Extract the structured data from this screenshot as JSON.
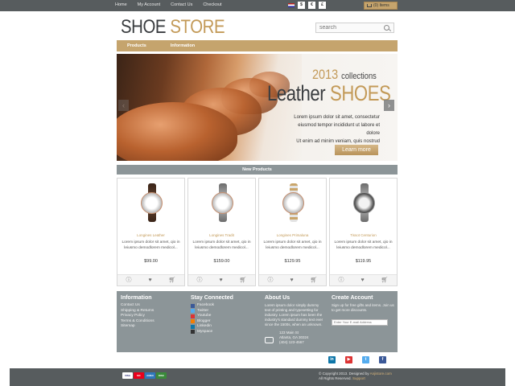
{
  "topbar": {
    "links": [
      "Home",
      "My Account",
      "Contact Us",
      "Checkout"
    ],
    "currencies": [
      "$",
      "€",
      "£"
    ],
    "cart_label": "(0) Items"
  },
  "header": {
    "logo_word1": "SHOE",
    "logo_word2": "STORE",
    "search_placeholder": "search"
  },
  "mainnav": [
    "Products",
    "Information"
  ],
  "slider": {
    "year": "2013",
    "collections": "collections",
    "title_word1": "Leather",
    "title_word2": "SHOES",
    "text_lines": [
      "Lorem ipsum dolor sit amet, consectetur",
      "eiusmod tempor incididunt ut labore et dolore",
      "Ut enim ad minim veniam, quis nostrud"
    ],
    "button": "Learn more",
    "prev": "‹",
    "next": "›"
  },
  "new_products": {
    "heading": "New Products",
    "items": [
      {
        "name": "Longines Leather",
        "desc": "Lorem ipsum dolor sit amet, qio in leiusmo demodlorem medicol...",
        "price": "$99.00"
      },
      {
        "name": "Longines Tradit",
        "desc": "Lorem ipsum dolor sit amet, qio in leiusmo demodlorem medicol...",
        "price": "$159.00"
      },
      {
        "name": "Longines Primaluna",
        "desc": "Lorem ipsum dolor sit amet, qio in leiusmo demodlorem medicol...",
        "price": "$129.95"
      },
      {
        "name": "Tissot Centurion",
        "desc": "Lorem ipsum dolor sit amet, qio in leiusmo demodlorem medicol...",
        "price": "$119.95"
      }
    ]
  },
  "footer": {
    "information": {
      "title": "Information",
      "links": [
        "Contact Us",
        "Shipping & Returns",
        "Privacy Policy",
        "Terms & Conditions",
        "Sitemap"
      ]
    },
    "stay_connected": {
      "title": "Stay Connected",
      "links": [
        "Facebook",
        "Twitter",
        "Youtube",
        "Blogger",
        "Linkedin",
        "Myspace"
      ]
    },
    "about": {
      "title": "About Us",
      "text": "Lorem ipsum dolor simply dummy text of printing and typesetting for industry. Lorem ipsum has been the industry's standard dummy text ever since the 1500s, when an unknown.",
      "address": [
        "123 Main St",
        "Atlanta, GA 30324",
        "(404) 123-4567"
      ]
    },
    "account": {
      "title": "Create Account",
      "text": "Sign up for free gifts and items. Join us to get more discounts.",
      "email_placeholder": "Enter Your E-mail Address"
    }
  },
  "social_buttons": [
    "in",
    "▶",
    "t",
    "f"
  ],
  "payment_cards": [
    "VISA",
    "MC",
    "AMEX",
    "DISC"
  ],
  "copyright": {
    "line1_prefix": "© Copyright 2013. Designed by",
    "line1_link": "Anjistore.com",
    "line2_prefix": "All Rights Reserved.",
    "line2_link": "Support"
  }
}
